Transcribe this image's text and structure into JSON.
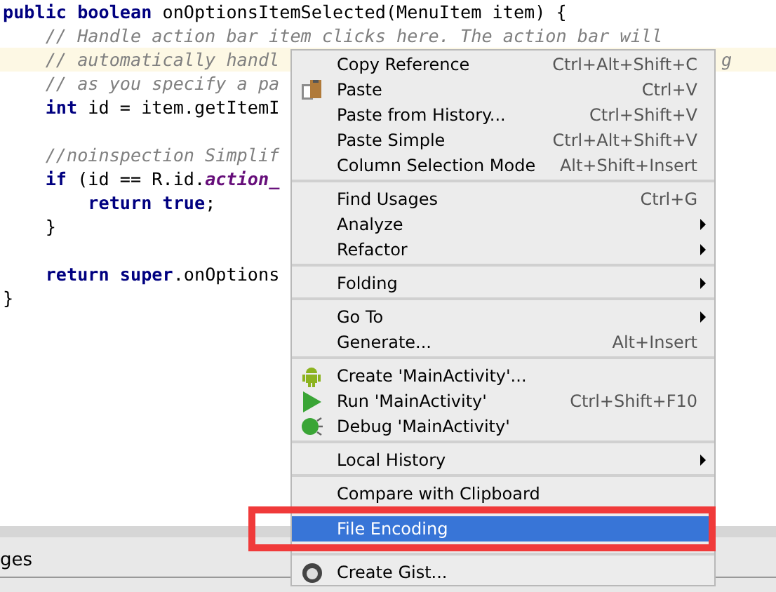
{
  "editor": {
    "lines": [
      {
        "parts": [
          {
            "t": "public boolean ",
            "kind": "keyword"
          },
          {
            "t": "onOptionsItemSelected(MenuItem item) {",
            "kind": "plain"
          }
        ],
        "highlighted": false
      },
      {
        "parts": [
          {
            "t": "    // Handle action bar item clicks here. The action bar will",
            "kind": "comment"
          }
        ],
        "highlighted": false
      },
      {
        "parts": [
          {
            "t": "    // automatically handl",
            "kind": "comment"
          }
        ],
        "highlighted": true,
        "tail": "g"
      },
      {
        "parts": [
          {
            "t": "    // as you specify a pa",
            "kind": "comment"
          }
        ],
        "highlighted": false
      },
      {
        "parts": [
          {
            "t": "    int ",
            "kind": "keyword"
          },
          {
            "t": "id = item.getItemI",
            "kind": "plain"
          }
        ],
        "highlighted": false
      },
      {
        "highlighted": false
      },
      {
        "parts": [
          {
            "t": "    //noinspection Simplif",
            "kind": "comment"
          }
        ],
        "highlighted": false
      },
      {
        "parts": [
          {
            "t": "    if ",
            "kind": "keyword"
          },
          {
            "t": "(id == R.id.",
            "kind": "plain"
          },
          {
            "t": "action_",
            "kind": "field"
          }
        ],
        "highlighted": false
      },
      {
        "parts": [
          {
            "t": "        return true",
            "kind": "keyword"
          },
          {
            "t": ";",
            "kind": "plain"
          }
        ],
        "highlighted": false
      },
      {
        "parts": [
          {
            "t": "    }",
            "kind": "plain"
          }
        ],
        "highlighted": false
      },
      {
        "highlighted": false
      },
      {
        "parts": [
          {
            "t": "    return super",
            "kind": "keyword"
          },
          {
            "t": ".onOptions",
            "kind": "plain"
          }
        ],
        "highlighted": false
      },
      {
        "parts": [
          {
            "t": "}",
            "kind": "plain"
          }
        ],
        "highlighted": false
      }
    ]
  },
  "bottom_panel": {
    "tab": "ges"
  },
  "context_menu": {
    "items": [
      {
        "kind": "plain",
        "label": "Copy Reference",
        "shortcut": "Ctrl+Alt+Shift+C",
        "submenu": false,
        "selected": false
      },
      {
        "kind": "paste",
        "label": "Paste",
        "shortcut": "Ctrl+V",
        "submenu": false,
        "selected": false
      },
      {
        "kind": "plain",
        "label": "Paste from History...",
        "shortcut": "Ctrl+Shift+V",
        "submenu": false,
        "selected": false
      },
      {
        "kind": "plain",
        "label": "Paste Simple",
        "shortcut": "Ctrl+Alt+Shift+V",
        "submenu": false,
        "selected": false
      },
      {
        "kind": "plain",
        "label": "Column Selection Mode",
        "shortcut": "Alt+Shift+Insert",
        "submenu": false,
        "selected": false
      },
      {
        "kind": "separator"
      },
      {
        "kind": "plain",
        "label": "Find Usages",
        "shortcut": "Ctrl+G",
        "submenu": false,
        "selected": false
      },
      {
        "kind": "plain",
        "label": "Analyze",
        "submenu": true,
        "selected": false
      },
      {
        "kind": "plain",
        "label": "Refactor",
        "submenu": true,
        "selected": false
      },
      {
        "kind": "separator"
      },
      {
        "kind": "plain",
        "label": "Folding",
        "submenu": true,
        "selected": false
      },
      {
        "kind": "separator"
      },
      {
        "kind": "plain",
        "label": "Go To",
        "submenu": true,
        "selected": false
      },
      {
        "kind": "plain",
        "label": "Generate...",
        "shortcut": "Alt+Insert",
        "submenu": false,
        "selected": false
      },
      {
        "kind": "separator"
      },
      {
        "kind": "android",
        "label": "Create 'MainActivity'...",
        "submenu": false,
        "selected": false
      },
      {
        "kind": "run",
        "label": "Run 'MainActivity'",
        "shortcut": "Ctrl+Shift+F10",
        "submenu": false,
        "selected": false
      },
      {
        "kind": "debug",
        "label": "Debug 'MainActivity'",
        "submenu": false,
        "selected": false
      },
      {
        "kind": "separator"
      },
      {
        "kind": "plain",
        "label": "Local History",
        "submenu": true,
        "selected": false
      },
      {
        "kind": "separator"
      },
      {
        "kind": "plain",
        "label": "Compare with Clipboard",
        "submenu": false,
        "selected": false
      },
      {
        "kind": "plain",
        "label": "File Encoding",
        "submenu": false,
        "selected": true
      },
      {
        "kind": "separator"
      },
      {
        "kind": "gist",
        "label": "Create Gist...",
        "submenu": false,
        "selected": false
      }
    ]
  }
}
